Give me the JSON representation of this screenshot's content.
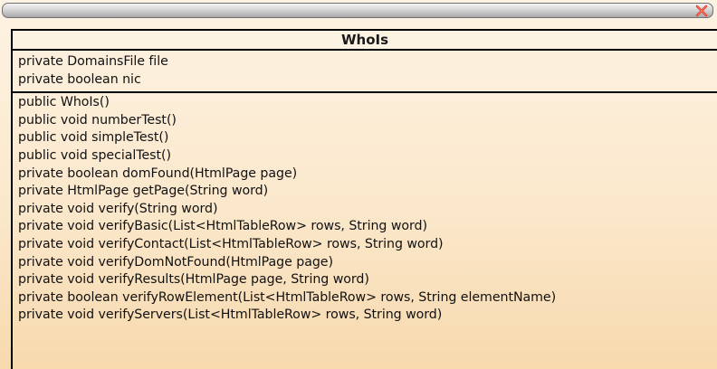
{
  "window": {
    "close_icon": "close-x-icon",
    "close_color": "#e43b2b"
  },
  "class": {
    "name": "WhoIs",
    "attributes": [
      "private DomainsFile file",
      "private boolean nic"
    ],
    "methods": [
      "public WhoIs()",
      "public void numberTest()",
      "public void simpleTest()",
      "public void specialTest()",
      "private boolean domFound(HtmlPage page)",
      "private HtmlPage getPage(String word)",
      "private void verify(String word)",
      "private void verifyBasic(List<HtmlTableRow> rows, String word)",
      "private void verifyContact(List<HtmlTableRow> rows, String word)",
      "private void verifyDomNotFound(HtmlPage page)",
      "private void verifyResults(HtmlPage page, String word)",
      "private boolean verifyRowElement(List<HtmlTableRow> rows, String elementName)",
      "private void verifyServers(List<HtmlTableRow> rows, String word)"
    ]
  }
}
